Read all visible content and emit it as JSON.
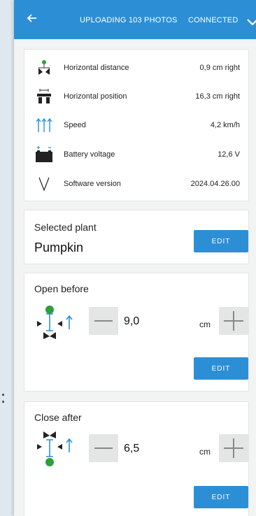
{
  "topbar": {
    "status": "UPLOADING 103 PHOTOS",
    "connection": "CONNECTED"
  },
  "info": [
    {
      "icon": "horizontal-distance-icon",
      "label": "Horizontal distance",
      "value": "0,9 cm right"
    },
    {
      "icon": "horizontal-position-icon",
      "label": "Horizontal position",
      "value": "16,3 cm right"
    },
    {
      "icon": "speed-icon",
      "label": "Speed",
      "value": "4,2 km/h"
    },
    {
      "icon": "battery-icon",
      "label": "Battery voltage",
      "value": "12,6 V"
    },
    {
      "icon": "software-version-icon",
      "label": "Software version",
      "value": "2024.04.26.00"
    }
  ],
  "selected_plant": {
    "title": "Selected plant",
    "value": "Pumpkin",
    "edit_label": "EDIT"
  },
  "open_before": {
    "title": "Open before",
    "value": "9,0",
    "unit": "cm",
    "edit_label": "EDIT"
  },
  "close_after": {
    "title": "Close after",
    "value": "6,5",
    "unit": "cm",
    "edit_label": "EDIT"
  },
  "colors": {
    "accent": "#2c8fd6",
    "plant_dot": "#2e9e3e"
  }
}
